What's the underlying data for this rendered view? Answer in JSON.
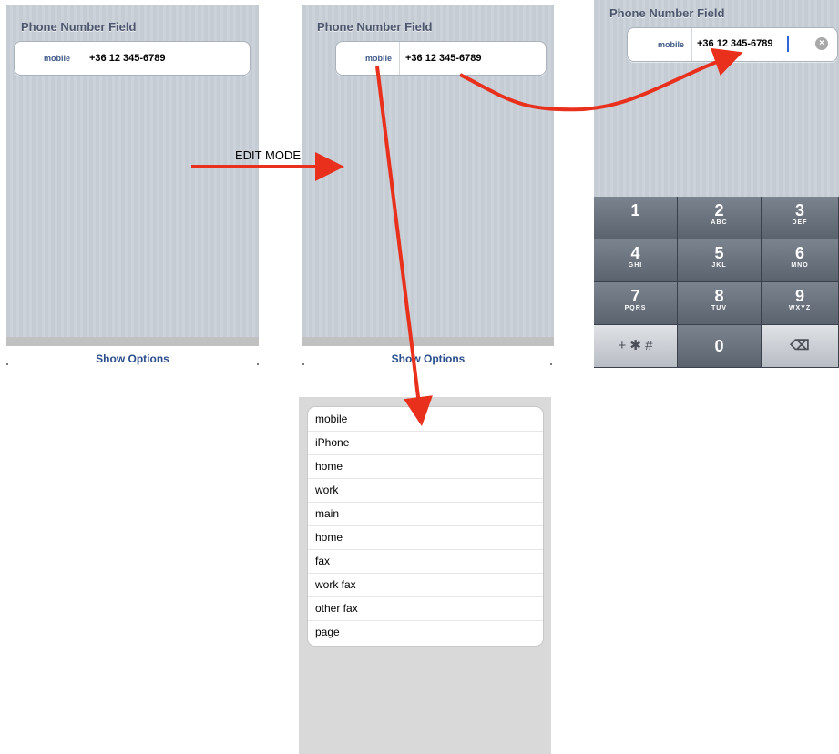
{
  "screen_title": "Phone Number Field",
  "phone": {
    "label": "mobile",
    "number": "+36 12 345-6789"
  },
  "footer": {
    "show_options": "Show Options"
  },
  "edit_mode_caption": "EDIT MODE",
  "keypad": [
    {
      "digit": "1",
      "letters": ""
    },
    {
      "digit": "2",
      "letters": "ABC"
    },
    {
      "digit": "3",
      "letters": "DEF"
    },
    {
      "digit": "4",
      "letters": "GHI"
    },
    {
      "digit": "5",
      "letters": "JKL"
    },
    {
      "digit": "6",
      "letters": "MNO"
    },
    {
      "digit": "7",
      "letters": "PQRS"
    },
    {
      "digit": "8",
      "letters": "TUV"
    },
    {
      "digit": "9",
      "letters": "WXYZ"
    }
  ],
  "keypad_bottom": {
    "symbols": "+ ✱ #",
    "zero": "0",
    "backspace": "⌫"
  },
  "label_options": [
    "mobile",
    "iPhone",
    "home",
    "work",
    "main",
    "home",
    "fax",
    "work fax",
    "other fax",
    "page"
  ],
  "colors": {
    "arrow": "#e8301c",
    "stripe_bg": "#c5ccd4",
    "label_blue": "#3f5a88"
  },
  "icons": {
    "clear": "clear-circle-icon",
    "backspace": "backspace-icon"
  }
}
